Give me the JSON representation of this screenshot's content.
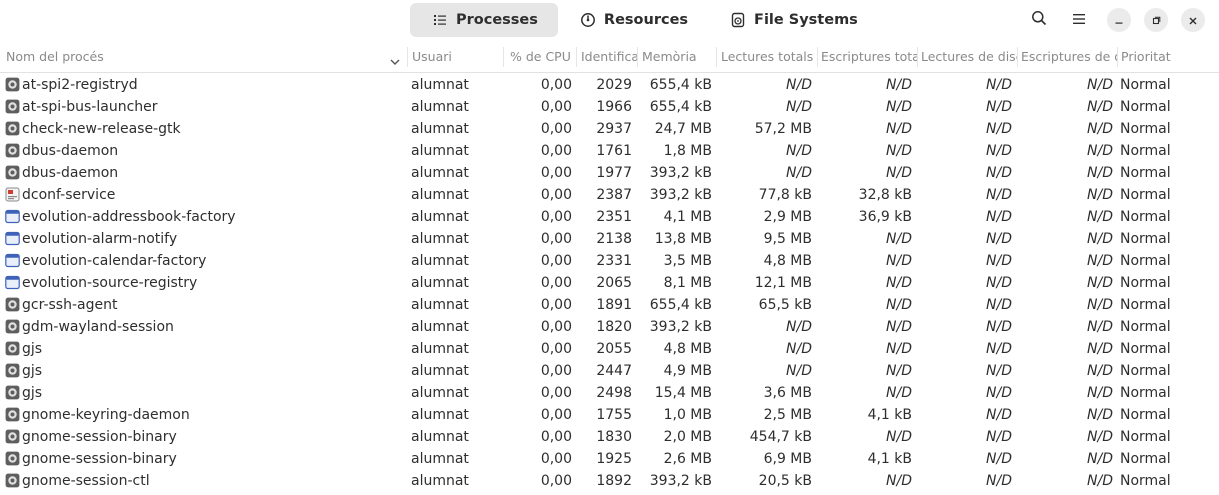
{
  "tabs": [
    {
      "label": "Processes",
      "icon": "list-icon",
      "active": true
    },
    {
      "label": "Resources",
      "icon": "gauge-icon",
      "active": false
    },
    {
      "label": "File Systems",
      "icon": "disk-icon",
      "active": false
    }
  ],
  "columns": {
    "name": "Nom del procés",
    "user": "Usuari",
    "cpu": "% de CPU",
    "id": "Identifica",
    "memory": "Memòria",
    "disk_read_total": "Lectures totals d",
    "disk_write_total": "Escriptures total",
    "disk_read": "Lectures de disc",
    "disk_write": "Escriptures de di",
    "priority": "Prioritat"
  },
  "processes": [
    {
      "name": "at-spi2-registryd",
      "icon": "gear",
      "user": "alumnat",
      "cpu": "0,00",
      "id": "2029",
      "memory": "655,4 kB",
      "read_total": "N/D",
      "write_total": "N/D",
      "read": "N/D",
      "write": "N/D",
      "priority": "Normal"
    },
    {
      "name": "at-spi-bus-launcher",
      "icon": "gear",
      "user": "alumnat",
      "cpu": "0,00",
      "id": "1966",
      "memory": "655,4 kB",
      "read_total": "N/D",
      "write_total": "N/D",
      "read": "N/D",
      "write": "N/D",
      "priority": "Normal"
    },
    {
      "name": "check-new-release-gtk",
      "icon": "gear",
      "user": "alumnat",
      "cpu": "0,00",
      "id": "2937",
      "memory": "24,7 MB",
      "read_total": "57,2 MB",
      "write_total": "N/D",
      "read": "N/D",
      "write": "N/D",
      "priority": "Normal"
    },
    {
      "name": "dbus-daemon",
      "icon": "gear",
      "user": "alumnat",
      "cpu": "0,00",
      "id": "1761",
      "memory": "1,8 MB",
      "read_total": "N/D",
      "write_total": "N/D",
      "read": "N/D",
      "write": "N/D",
      "priority": "Normal"
    },
    {
      "name": "dbus-daemon",
      "icon": "gear",
      "user": "alumnat",
      "cpu": "0,00",
      "id": "1977",
      "memory": "393,2 kB",
      "read_total": "N/D",
      "write_total": "N/D",
      "read": "N/D",
      "write": "N/D",
      "priority": "Normal"
    },
    {
      "name": "dconf-service",
      "icon": "settings-red",
      "user": "alumnat",
      "cpu": "0,00",
      "id": "2387",
      "memory": "393,2 kB",
      "read_total": "77,8 kB",
      "write_total": "32,8 kB",
      "read": "N/D",
      "write": "N/D",
      "priority": "Normal"
    },
    {
      "name": "evolution-addressbook-factory",
      "icon": "window",
      "user": "alumnat",
      "cpu": "0,00",
      "id": "2351",
      "memory": "4,1 MB",
      "read_total": "2,9 MB",
      "write_total": "36,9 kB",
      "read": "N/D",
      "write": "N/D",
      "priority": "Normal"
    },
    {
      "name": "evolution-alarm-notify",
      "icon": "window",
      "user": "alumnat",
      "cpu": "0,00",
      "id": "2138",
      "memory": "13,8 MB",
      "read_total": "9,5 MB",
      "write_total": "N/D",
      "read": "N/D",
      "write": "N/D",
      "priority": "Normal"
    },
    {
      "name": "evolution-calendar-factory",
      "icon": "window",
      "user": "alumnat",
      "cpu": "0,00",
      "id": "2331",
      "memory": "3,5 MB",
      "read_total": "4,8 MB",
      "write_total": "N/D",
      "read": "N/D",
      "write": "N/D",
      "priority": "Normal"
    },
    {
      "name": "evolution-source-registry",
      "icon": "window",
      "user": "alumnat",
      "cpu": "0,00",
      "id": "2065",
      "memory": "8,1 MB",
      "read_total": "12,1 MB",
      "write_total": "N/D",
      "read": "N/D",
      "write": "N/D",
      "priority": "Normal"
    },
    {
      "name": "gcr-ssh-agent",
      "icon": "gear",
      "user": "alumnat",
      "cpu": "0,00",
      "id": "1891",
      "memory": "655,4 kB",
      "read_total": "65,5 kB",
      "write_total": "N/D",
      "read": "N/D",
      "write": "N/D",
      "priority": "Normal"
    },
    {
      "name": "gdm-wayland-session",
      "icon": "gear",
      "user": "alumnat",
      "cpu": "0,00",
      "id": "1820",
      "memory": "393,2 kB",
      "read_total": "N/D",
      "write_total": "N/D",
      "read": "N/D",
      "write": "N/D",
      "priority": "Normal"
    },
    {
      "name": "gjs",
      "icon": "gear",
      "user": "alumnat",
      "cpu": "0,00",
      "id": "2055",
      "memory": "4,8 MB",
      "read_total": "N/D",
      "write_total": "N/D",
      "read": "N/D",
      "write": "N/D",
      "priority": "Normal"
    },
    {
      "name": "gjs",
      "icon": "gear",
      "user": "alumnat",
      "cpu": "0,00",
      "id": "2447",
      "memory": "4,9 MB",
      "read_total": "N/D",
      "write_total": "N/D",
      "read": "N/D",
      "write": "N/D",
      "priority": "Normal"
    },
    {
      "name": "gjs",
      "icon": "gear",
      "user": "alumnat",
      "cpu": "0,00",
      "id": "2498",
      "memory": "15,4 MB",
      "read_total": "3,6 MB",
      "write_total": "N/D",
      "read": "N/D",
      "write": "N/D",
      "priority": "Normal"
    },
    {
      "name": "gnome-keyring-daemon",
      "icon": "gear",
      "user": "alumnat",
      "cpu": "0,00",
      "id": "1755",
      "memory": "1,0 MB",
      "read_total": "2,5 MB",
      "write_total": "4,1 kB",
      "read": "N/D",
      "write": "N/D",
      "priority": "Normal"
    },
    {
      "name": "gnome-session-binary",
      "icon": "gear",
      "user": "alumnat",
      "cpu": "0,00",
      "id": "1830",
      "memory": "2,0 MB",
      "read_total": "454,7 kB",
      "write_total": "N/D",
      "read": "N/D",
      "write": "N/D",
      "priority": "Normal"
    },
    {
      "name": "gnome-session-binary",
      "icon": "gear",
      "user": "alumnat",
      "cpu": "0,00",
      "id": "1925",
      "memory": "2,6 MB",
      "read_total": "6,9 MB",
      "write_total": "4,1 kB",
      "read": "N/D",
      "write": "N/D",
      "priority": "Normal"
    },
    {
      "name": "gnome-session-ctl",
      "icon": "gear",
      "user": "alumnat",
      "cpu": "0,00",
      "id": "1892",
      "memory": "393,2 kB",
      "read_total": "20,5 kB",
      "write_total": "N/D",
      "read": "N/D",
      "write": "N/D",
      "priority": "Normal"
    }
  ]
}
